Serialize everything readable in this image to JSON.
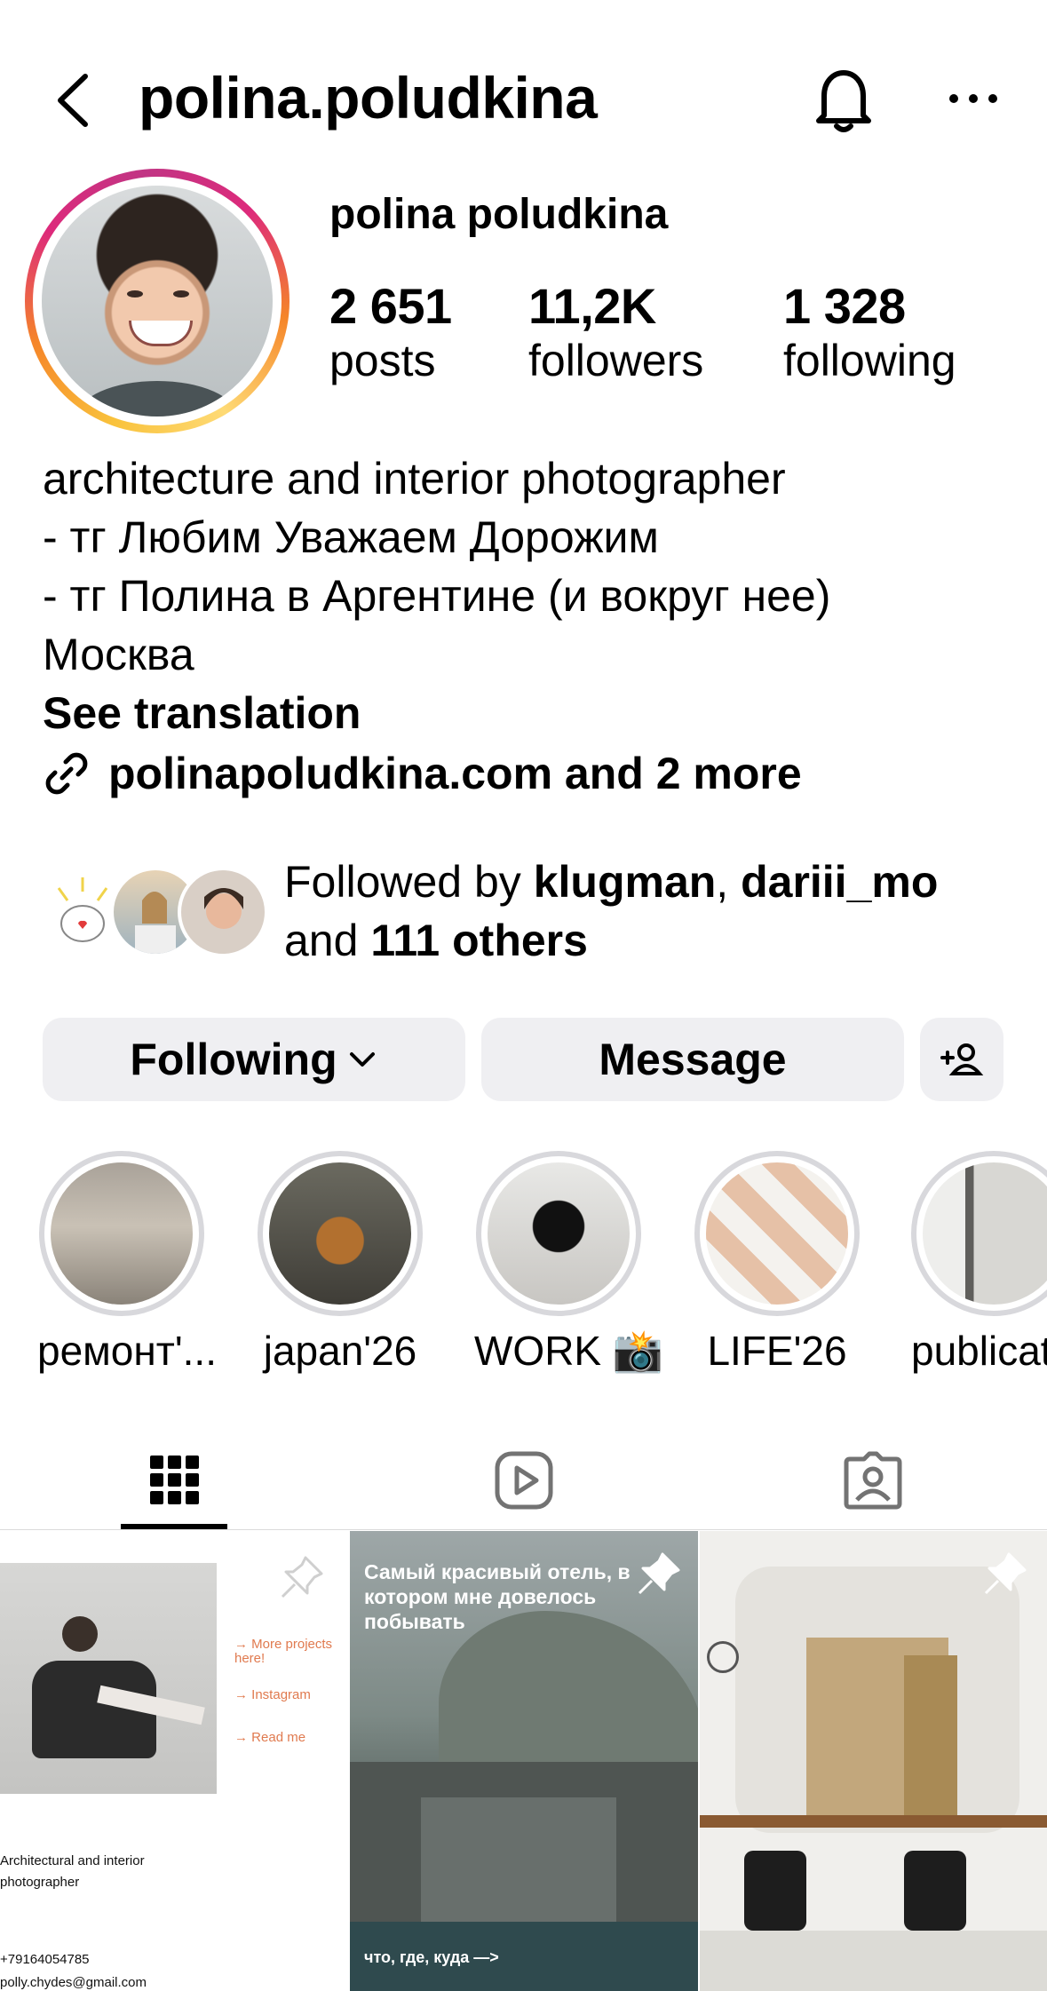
{
  "header": {
    "username": "polina.poludkina"
  },
  "profile": {
    "display_name": "polina poludkina",
    "stats": [
      {
        "value": "2 651",
        "label": "posts"
      },
      {
        "value": "11,2K",
        "label": "followers"
      },
      {
        "value": "1 328",
        "label": "following"
      }
    ],
    "bio_lines": [
      "architecture and interior photographer",
      "- тг Любим Уважаем Дорожим",
      "- тг Полина в Аргентине (и вокруг нее)",
      "Москва"
    ],
    "see_translation": "See translation",
    "link_text": "polinapoludkina.com and 2 more"
  },
  "followed_by": {
    "prefix": "Followed by ",
    "user1": "klugman",
    "sep": ", ",
    "user2": "dariii_mo",
    "and": "and ",
    "others": "111 others"
  },
  "buttons": {
    "following": "Following",
    "message": "Message"
  },
  "highlights": [
    {
      "label": "ремонт'..."
    },
    {
      "label": "japan'26"
    },
    {
      "label": "WORK 📸"
    },
    {
      "label": "LIFE'26"
    },
    {
      "label": "publicat"
    }
  ],
  "posts": {
    "post1": {
      "links": [
        "More projects here!",
        "Instagram",
        "Read me"
      ],
      "caption": "Architectural and interior photographer",
      "phone": "+79164054785",
      "email": "polly.chydes@gmail.com"
    },
    "post2": {
      "title": "Самый красивый отель, в котором мне довелось побывать",
      "footer": "что, где, куда —>"
    }
  },
  "colors": {
    "button_bg": "#efeff2",
    "highlight_ring": "#d8d8dc",
    "link_orange": "#e07a4f"
  }
}
